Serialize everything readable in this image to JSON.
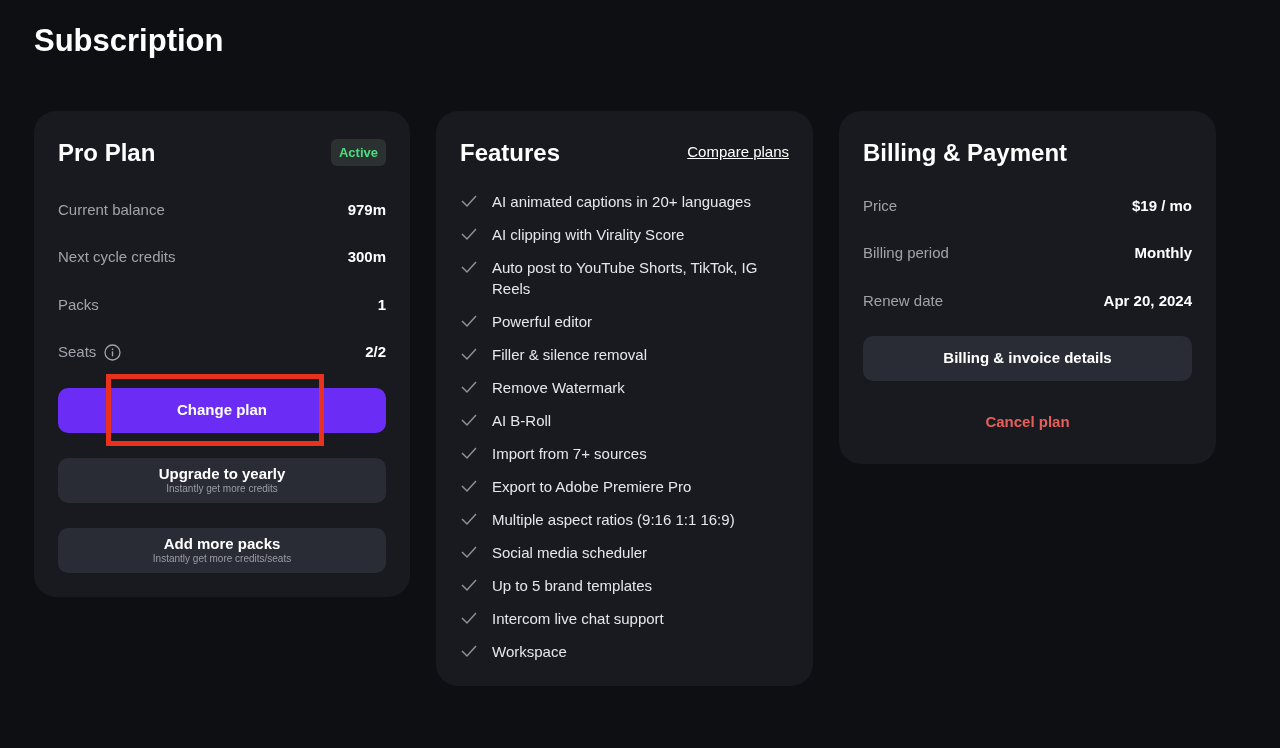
{
  "page": {
    "title": "Subscription"
  },
  "plan": {
    "title": "Pro Plan",
    "badge": "Active",
    "rows": [
      {
        "label": "Current balance",
        "value": "979m",
        "info": false
      },
      {
        "label": "Next cycle credits",
        "value": "300m",
        "info": false
      },
      {
        "label": "Packs",
        "value": "1",
        "info": false
      },
      {
        "label": "Seats",
        "value": "2/2",
        "info": true
      }
    ],
    "buttons": [
      {
        "kind": "primary",
        "label": "Change plan",
        "highlighted": true
      },
      {
        "kind": "secondary",
        "label": "Upgrade to yearly",
        "sublabel": "Instantly get more credits",
        "highlighted": false
      },
      {
        "kind": "secondary",
        "label": "Add more packs",
        "sublabel": "Instantly get more credits/seats",
        "highlighted": false
      }
    ]
  },
  "features": {
    "title": "Features",
    "link": "Compare plans",
    "items": [
      "AI animated captions in 20+ languages",
      "AI clipping with Virality Score",
      "Auto post to YouTube Shorts, TikTok, IG Reels",
      "Powerful editor",
      "Filler & silence removal",
      "Remove Watermark",
      "AI B-Roll",
      "Import from 7+ sources",
      "Export to Adobe Premiere Pro",
      "Multiple aspect ratios (9:16 1:1 16:9)",
      "Social media scheduler",
      "Up to 5 brand templates",
      "Intercom live chat support",
      "Workspace"
    ]
  },
  "billing": {
    "title": "Billing & Payment",
    "rows": [
      {
        "label": "Price",
        "value": "$19 / mo"
      },
      {
        "label": "Billing period",
        "value": "Monthly"
      },
      {
        "label": "Renew date",
        "value": "Apr 20, 2024"
      }
    ],
    "button": "Billing & invoice details",
    "cancel": "Cancel plan"
  }
}
